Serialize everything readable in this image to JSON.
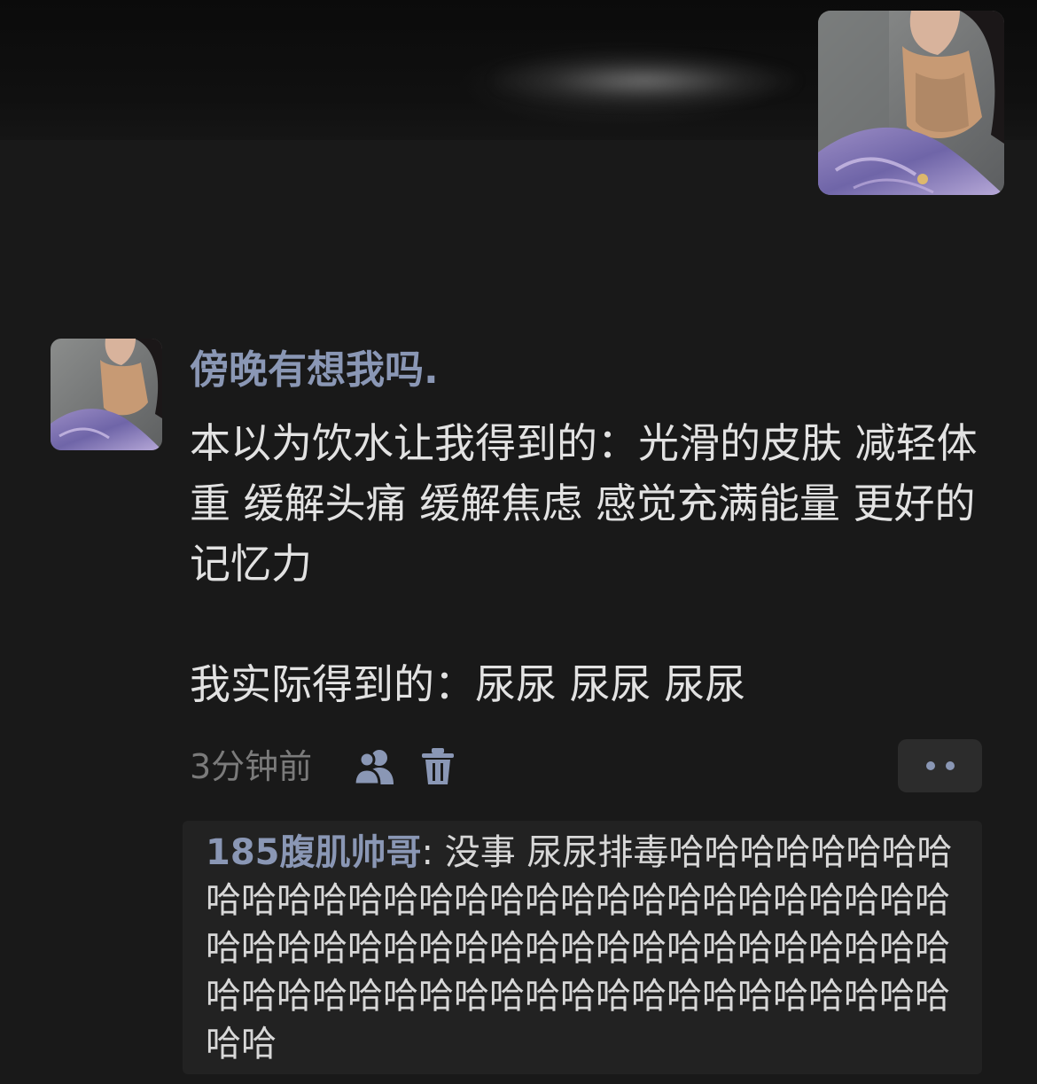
{
  "cover": {
    "icon": "profile-cover-photo"
  },
  "post": {
    "author": "傍晚有想我吗.",
    "paragraphs": [
      "本以为饮水让我得到的：光滑的皮肤 减轻体重 缓解头痛 缓解焦虑 感觉充满能量 更好的记忆力",
      "我实际得到的：尿尿 尿尿 尿尿"
    ],
    "time": "3分钟前",
    "icons": {
      "visibility": "friends-icon",
      "delete": "trash-icon",
      "more": "more-dots-icon"
    }
  },
  "comments": [
    {
      "author": "185腹肌帅哥",
      "separator": ": ",
      "text": "没事 尿尿排毒哈哈哈哈哈哈哈哈哈哈哈哈哈哈哈哈哈哈哈哈哈哈哈哈哈哈哈哈哈哈哈哈哈哈哈哈哈哈哈哈哈哈哈哈哈哈哈哈哈哈哈哈哈哈哈哈哈哈哈哈哈哈哈哈哈哈哈哈哈哈哈哈哈"
    }
  ],
  "colors": {
    "background": "#191919",
    "name_accent": "#8a97b5",
    "comment_bg": "#222222",
    "muted_text": "#7b7b7b"
  }
}
